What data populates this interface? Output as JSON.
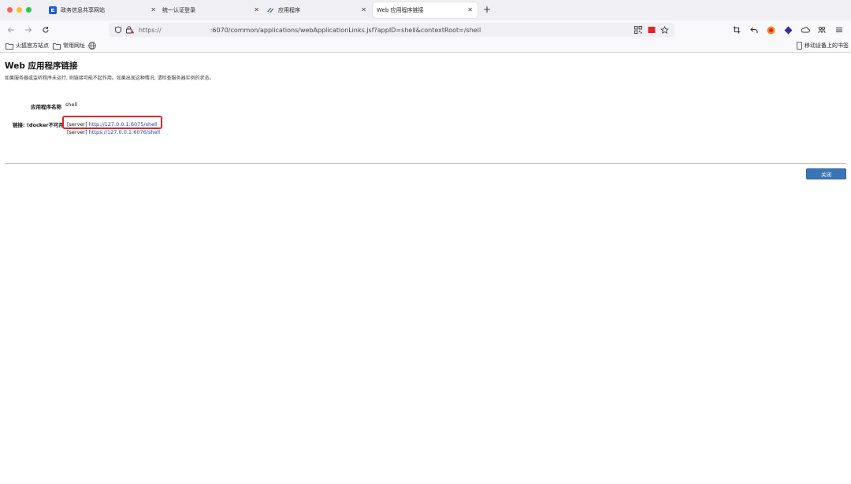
{
  "tabs": [
    {
      "title": "政务信息共享网站",
      "icon": "gov-site-icon",
      "active": false
    },
    {
      "title": "统一认证登录",
      "icon": "",
      "active": false
    },
    {
      "title": "应用程序",
      "icon": "app-logo-icon",
      "active": false
    },
    {
      "title": "Web 应用程序链接",
      "icon": "",
      "active": true
    }
  ],
  "address_bar": {
    "scheme": "https://",
    "rest": ":6070/common/applications/webApplicationLinks.jsf?appID=shell&contextRoot=/shell"
  },
  "bookmarks": {
    "items": [
      {
        "label": "火狐官方站点",
        "icon": "folder-icon"
      },
      {
        "label": "常用网址",
        "icon": "folder-icon"
      }
    ],
    "mobile": "移动设备上的书签"
  },
  "page": {
    "title": "Web 应用程序链接",
    "description": "如果服务器或监听程序未运行, 则链接可能不起作用。如果出现这种情况, 请检查服务器实例的状态。",
    "app_name_label": "应用程序名称",
    "app_name_value": "shell",
    "links_label": "链接: (docker不可用",
    "links": [
      {
        "tag": "[server]",
        "url": "http://127.0.0.1:6075/shell"
      },
      {
        "tag": "[server]",
        "url": "https://127.0.0.1:6076/shell"
      }
    ],
    "close_button": "关闭"
  },
  "colors": {
    "accent_button": "#3a76b5",
    "highlight_border": "#e0242b",
    "link": "#1a3fa8"
  }
}
